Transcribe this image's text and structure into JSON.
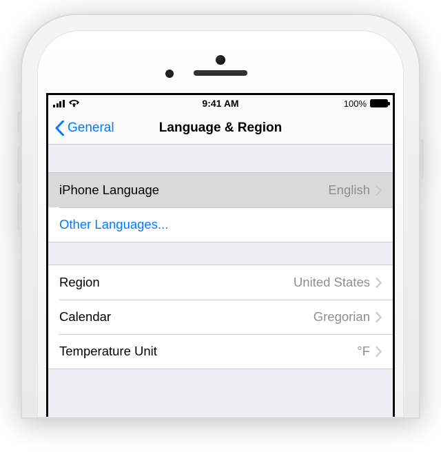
{
  "status_bar": {
    "time": "9:41 AM",
    "battery_pct": "100%"
  },
  "nav": {
    "back_label": "General",
    "title": "Language & Region"
  },
  "group1": {
    "iphone_language": {
      "label": "iPhone Language",
      "value": "English"
    },
    "other_languages": {
      "label": "Other Languages..."
    }
  },
  "group2": {
    "region": {
      "label": "Region",
      "value": "United States"
    },
    "calendar": {
      "label": "Calendar",
      "value": "Gregorian"
    },
    "temperature": {
      "label": "Temperature Unit",
      "value": "°F"
    }
  }
}
